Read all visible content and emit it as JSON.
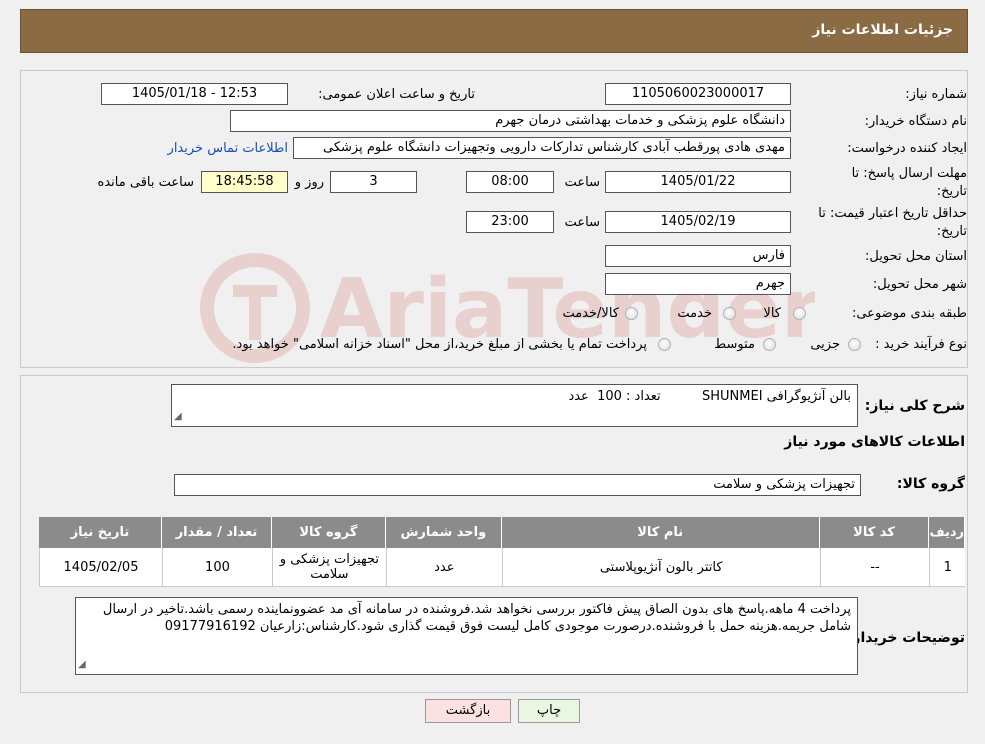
{
  "header": {
    "title": "جزئیات اطلاعات نیاز"
  },
  "form": {
    "need_number": {
      "label": "شماره نیاز:",
      "value": "1105060023000017"
    },
    "announce_date": {
      "label": "تاریخ و ساعت اعلان عمومی:",
      "value": "1405/01/18 - 12:53"
    },
    "buyer_org": {
      "label": "نام دستگاه خریدار:",
      "value": "دانشگاه علوم پزشکی و خدمات بهداشتی  درمان جهرم"
    },
    "requester": {
      "label": "ایجاد کننده درخواست:",
      "value": "مهدی هادی پورقطب آبادی کارشناس تدارکات دارویی وتجهیزات دانشگاه علوم پزشکی",
      "contact_link": "اطلاعات تماس خریدار"
    },
    "send_deadline": {
      "label_line1": "مهلت ارسال پاسخ: تا",
      "label_line2": "تاریخ:",
      "date": "1405/01/22",
      "time_label": "ساعت",
      "time": "08:00",
      "days": "3",
      "days_label": "روز و",
      "remaining": "18:45:58",
      "remaining_label": "ساعت باقی مانده"
    },
    "price_validity": {
      "label_line1": "حداقل تاریخ اعتبار قیمت: تا",
      "label_line2": "تاریخ:",
      "date": "1405/02/19",
      "time_label": "ساعت",
      "time": "23:00"
    },
    "province": {
      "label": "استان محل تحویل:",
      "value": "فارس"
    },
    "city": {
      "label": "شهر محل تحویل:",
      "value": "جهرم"
    },
    "category": {
      "label": "طبقه بندی موضوعی:",
      "options": [
        "کالا",
        "خدمت",
        "کالا/خدمت"
      ]
    },
    "purchase_type": {
      "label": "نوع فرآیند خرید :",
      "options": [
        "جزیی",
        "متوسط"
      ],
      "note": "پرداخت تمام یا بخشی از مبلغ خرید،از محل \"اسناد خزانه اسلامی\" خواهد بود."
    }
  },
  "summary": {
    "label": "شرح کلی نیاز:",
    "value": "بالن آنژیوگرافی SHUNMEI          تعداد : 100  عدد",
    "items_title": "اطلاعات کالاهای مورد نیاز",
    "group_label": "گروه کالا:",
    "group_value": "تجهیزات پزشکی و سلامت"
  },
  "table": {
    "headers": [
      "ردیف",
      "کد کالا",
      "نام کالا",
      "واحد شمارش",
      "گروه کالا",
      "تعداد / مقدار",
      "تاریخ نیاز"
    ],
    "rows": [
      [
        "1",
        "--",
        "کاتتر بالون آنژیوپلاستی",
        "عدد",
        "تجهیزات پزشکی و سلامت",
        "100",
        "1405/02/05"
      ]
    ]
  },
  "buyer_notes": {
    "label": "توضیحات خریدار:",
    "value": "پرداخت 4 ماهه.پاسخ های بدون الصاق پیش فاکتور بررسی نخواهد شد.فروشنده در سامانه آی مد عضوونماینده رسمی باشد.تاخیر در ارسال شامل جریمه.هزینه حمل با فروشنده.درصورت موجودی کامل لیست فوق قیمت گذاری شود.کارشناس:زارعیان 09177916192"
  },
  "buttons": {
    "print": "چاپ",
    "back": "بازگشت"
  },
  "watermark": {
    "text": "AriaTender.neT",
    "color": "#c0392b"
  }
}
